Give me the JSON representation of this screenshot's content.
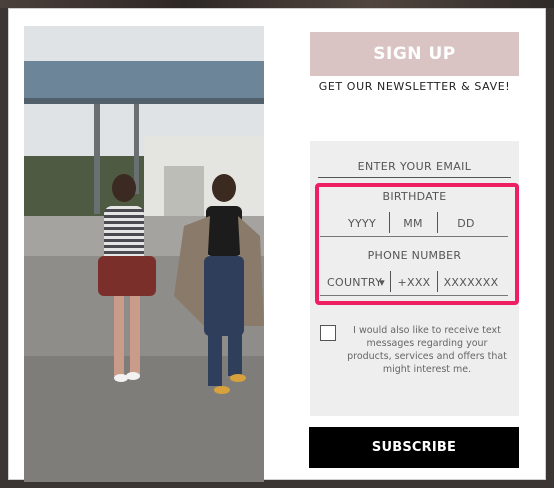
{
  "popup": {
    "signup_label": "SIGN UP",
    "subtitle": "GET OUR NEWSLETTER & SAVE!",
    "email_label": "ENTER YOUR EMAIL",
    "birthdate": {
      "label": "BIRTHDATE",
      "year": "YYYY",
      "month": "MM",
      "day": "DD"
    },
    "phone": {
      "label": "PHONE NUMBER",
      "country": "COUNTRY",
      "code": "+XXX",
      "number": "XXXXXXX"
    },
    "consent_text": "I would also like to receive text messages regarding your products, services and offers that might interest me.",
    "subscribe_label": "SUBSCRIBE",
    "colors": {
      "banner": "#d9c4c3",
      "highlight": "#ee1f62",
      "panel": "#efeeee",
      "button": "#000000"
    }
  }
}
